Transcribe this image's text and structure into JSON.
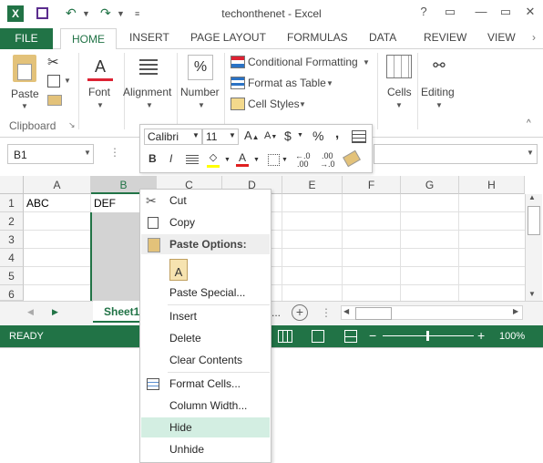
{
  "window": {
    "title": "techonthenet - Excel"
  },
  "qat": {
    "undo": "↶",
    "redo": "↷",
    "help": "?",
    "minimize": "—",
    "restore": "▭",
    "close": "✕"
  },
  "tabs": [
    "FILE",
    "HOME",
    "INSERT",
    "PAGE LAYOUT",
    "FORMULAS",
    "DATA",
    "REVIEW",
    "VIEW"
  ],
  "ribbon": {
    "paste": "Paste",
    "clipboard_group": "Clipboard",
    "font": "Font",
    "alignment": "Alignment",
    "number": "Number",
    "conditional_formatting": "Conditional Formatting",
    "format_as_table": "Format as Table",
    "cell_styles": "Cell Styles",
    "cells": "Cells",
    "editing": "Editing"
  },
  "formula_bar": {
    "name_box": "B1"
  },
  "grid": {
    "columns": [
      "A",
      "B",
      "C",
      "D",
      "E",
      "F",
      "G",
      "H"
    ],
    "rows": [
      "1",
      "2",
      "3",
      "4",
      "5",
      "6"
    ],
    "a1": "ABC",
    "b1": "DEF"
  },
  "sheet_tabs": {
    "active": "Sheet1",
    "more": "..."
  },
  "status": {
    "ready": "READY",
    "zoom": "100%"
  },
  "mini_toolbar": {
    "font_name": "Calibri",
    "font_size": "11",
    "currency": "$",
    "percent": "%",
    "comma": ","
  },
  "context_menu": {
    "cut": "Cut",
    "copy": "Copy",
    "paste_options": "Paste Options:",
    "paste_special": "Paste Special...",
    "insert": "Insert",
    "delete": "Delete",
    "clear_contents": "Clear Contents",
    "format_cells": "Format Cells...",
    "column_width": "Column Width...",
    "hide": "Hide",
    "unhide": "Unhide"
  },
  "colors": {
    "brand": "#217346",
    "highlight": "#d3eee2"
  }
}
